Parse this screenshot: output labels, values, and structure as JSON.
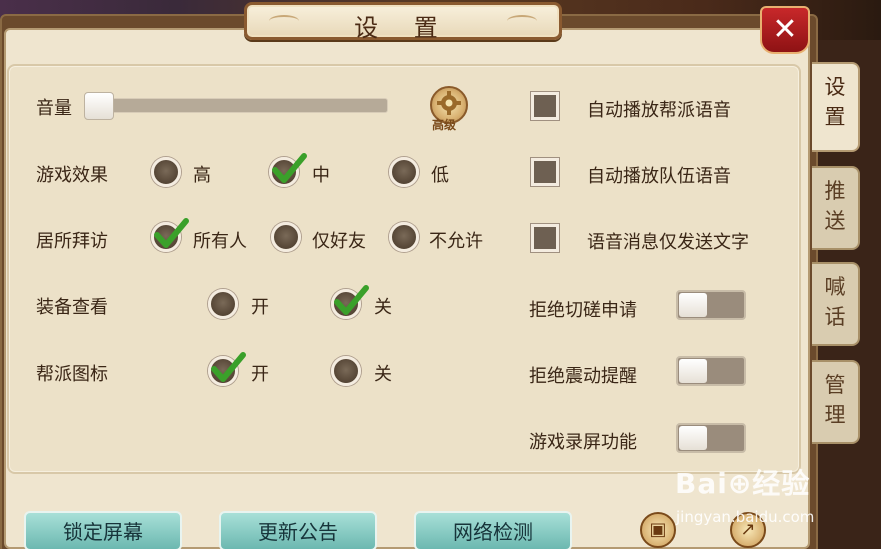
{
  "title": "设 置",
  "side_tabs": [
    {
      "label": "设\n置",
      "active": true
    },
    {
      "label": "推\n送",
      "active": false
    },
    {
      "label": "喊\n话",
      "active": false
    },
    {
      "label": "管\n理",
      "active": false
    }
  ],
  "volume": {
    "label": "音量",
    "level": 0.0,
    "advanced_label": "高级"
  },
  "game_effect": {
    "label": "游戏效果",
    "options": [
      "高",
      "中",
      "低"
    ],
    "selected": "中"
  },
  "home_visit": {
    "label": "居所拜访",
    "options": [
      "所有人",
      "仅好友",
      "不允许"
    ],
    "selected": "所有人"
  },
  "equip_view": {
    "label": "装备查看",
    "options": [
      "开",
      "关"
    ],
    "selected": "关"
  },
  "guild_icon": {
    "label": "帮派图标",
    "options": [
      "开",
      "关"
    ],
    "selected": "开"
  },
  "checkboxes": [
    {
      "label": "自动播放帮派语音",
      "checked": false
    },
    {
      "label": "自动播放队伍语音",
      "checked": false
    },
    {
      "label": "语音消息仅发送文字",
      "checked": false
    }
  ],
  "toggles": [
    {
      "label": "拒绝切磋申请",
      "on": false
    },
    {
      "label": "拒绝震动提醒",
      "on": false
    },
    {
      "label": "游戏录屏功能",
      "on": false
    }
  ],
  "bottom_buttons": [
    "锁定屏幕",
    "更新公告",
    "网络检测"
  ],
  "close_symbol": "✕",
  "watermark": {
    "text": "Bai⊕经验",
    "sub": "jingyan.baidu.com"
  },
  "icons": {
    "gear": "gear-icon",
    "gift": "gift-icon",
    "share": "share-icon",
    "check": "checkmark-icon"
  },
  "colors": {
    "check": "#3aa02a",
    "accent_red": "#b01c1e",
    "button_teal": "#8ed0c8"
  }
}
